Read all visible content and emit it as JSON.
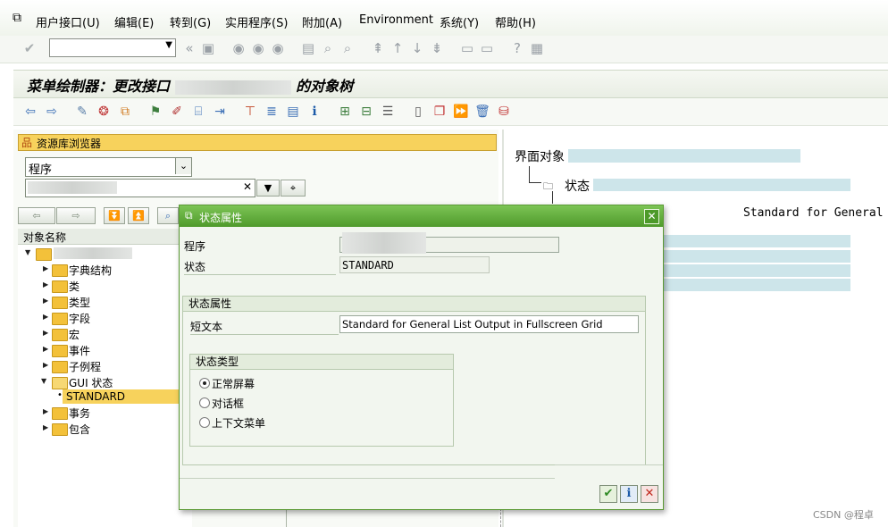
{
  "menu": {
    "items": [
      "用户接口(U)",
      "编辑(E)",
      "转到(G)",
      "实用程序(S)",
      "附加(A)",
      "Environment",
      "系统(Y)",
      "帮助(H)"
    ]
  },
  "screen": {
    "title_prefix": "菜单绘制器：更改接口",
    "title_suffix": "的对象树"
  },
  "repository": {
    "header": "资源库浏览器",
    "object_type": "程序",
    "tree_header": "对象名称",
    "tree": [
      {
        "label": "字典结构",
        "type": "folder"
      },
      {
        "label": "类",
        "type": "folder"
      },
      {
        "label": "类型",
        "type": "folder"
      },
      {
        "label": "字段",
        "type": "folder"
      },
      {
        "label": "宏",
        "type": "folder"
      },
      {
        "label": "事件",
        "type": "folder"
      },
      {
        "label": "子例程",
        "type": "folder"
      },
      {
        "label": "GUI 状态",
        "type": "folder-open"
      },
      {
        "label": "STANDARD",
        "type": "leaf-selected"
      },
      {
        "label": "事务",
        "type": "folder"
      },
      {
        "label": "包含",
        "type": "folder"
      }
    ]
  },
  "object_tree": {
    "root": "界面对象",
    "node_status": "状态",
    "status_text": "Standard for General"
  },
  "dialog": {
    "title": "状态属性",
    "program_label": "程序",
    "status_label": "状态",
    "status_value": "STANDARD",
    "attr_group_title": "状态属性",
    "short_text_label": "短文本",
    "short_text_value": "Standard for General List Output in Fullscreen Grid",
    "type_group_title": "状态类型",
    "radio_options": [
      "正常屏幕",
      "对话框",
      "上下文菜单"
    ],
    "radio_selected": "正常屏幕"
  },
  "watermark": "CSDN @程卓"
}
